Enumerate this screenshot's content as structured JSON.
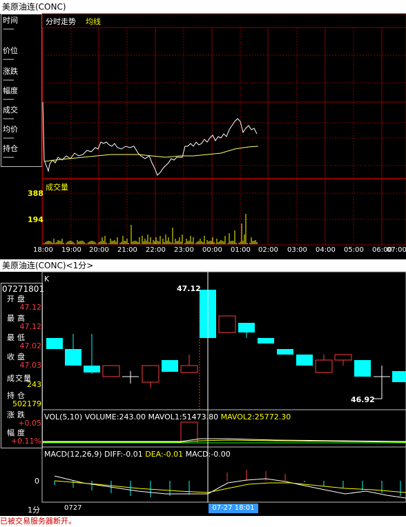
{
  "intraday": {
    "window_title": "美原油连(CONC)",
    "header_title": "分时走势",
    "header_avg": "均线",
    "side_labels": [
      "时间",
      "价位",
      "涨跌",
      "幅度",
      "成交",
      "均价",
      "持仓"
    ],
    "side_dash": "------",
    "volume_title": "成交量",
    "volume_ticks": [
      "388",
      "194"
    ],
    "time_ticks": [
      "18:00",
      "19:00",
      "20:00",
      "21:00",
      "22:00",
      "23:00",
      "00:00",
      "01:00",
      "02:00",
      "03:00",
      "04:00",
      "05:00",
      "06:00",
      "07:00"
    ]
  },
  "kline": {
    "window_title": "美原油连(CONC)<1分>",
    "k_label": "K",
    "side": {
      "date": "07271801",
      "open_label": "开盘",
      "open_value": "47.12",
      "high_label": "最高",
      "high_value": "47.12",
      "low_label": "最低",
      "low_value": "47.02",
      "close_label": "收盘",
      "close_value": "47.03",
      "volume_label": "成交量",
      "volume_value": "243",
      "oi_label": "持仓",
      "oi_value": "502179",
      "change_label": "涨跌",
      "change_value": "+0.05",
      "pct_label": "幅度",
      "pct_value": "+0.11%"
    },
    "high_marker": "47.12",
    "low_marker": "46.92",
    "vol_header": {
      "main": "VOL(5,10) VOLUME:243.00",
      "mavol1": "MAVOL1:51473.80",
      "mavol2": "MAVOL2:25772.30"
    },
    "macd_header": {
      "name": "MACD(12,26,9)",
      "diff": "DIFF:-0.01",
      "dea": "DEA:-0.01",
      "macd": "MACD:-0.00"
    },
    "macd_zero": "0",
    "period_label": "1分",
    "date_left": "0727",
    "cursor_date": "07-27 18:01"
  },
  "status_text": "已被交易服务器断开。",
  "colors": {
    "grid": "#8b0000",
    "up": "#ff3c3c",
    "down": "#00ffff",
    "price": "#ffffff",
    "avg": "#ffff66",
    "volume": "#ffff00",
    "mavol2": "#ffff00"
  }
}
